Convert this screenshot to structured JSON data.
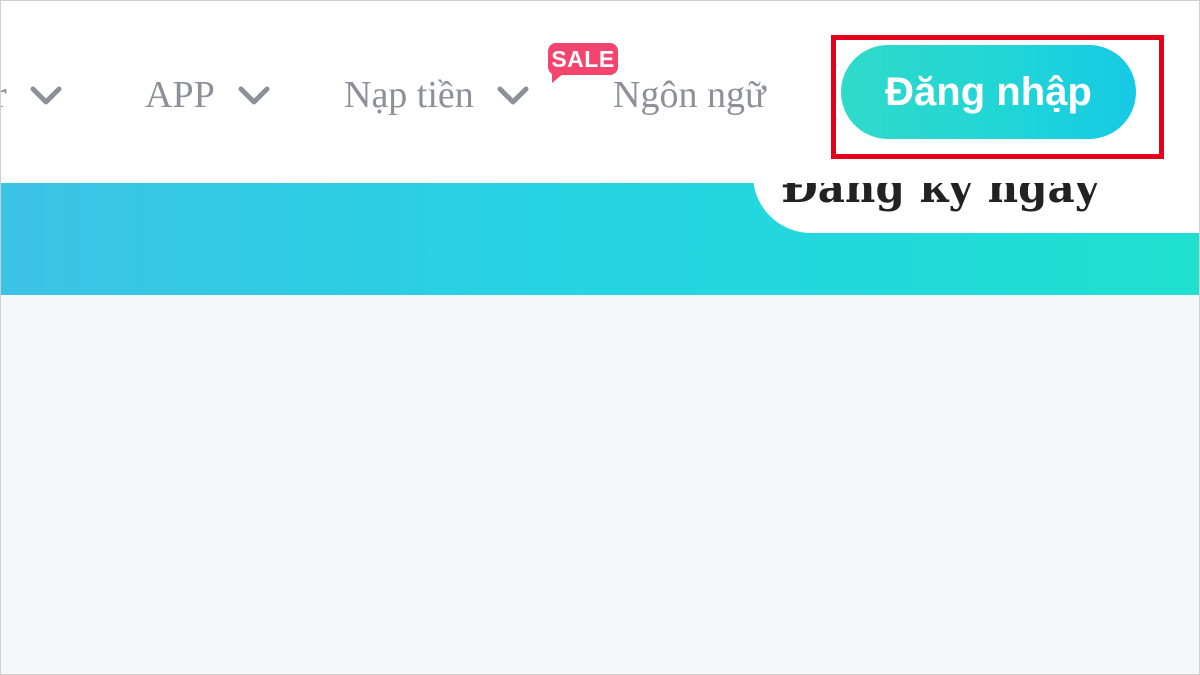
{
  "nav": {
    "partial_item": "or",
    "app": "APP",
    "topup": "Nạp tiền",
    "sale_badge": "SALE",
    "language": "Ngôn ngữ",
    "login_button": "Đăng nhập"
  },
  "banner": {
    "card_text": "Đăng ký ngay"
  },
  "colors": {
    "nav_text": "#8c9099",
    "sale_badge": "#f5456f",
    "login_gradient_start": "#2fdac9",
    "login_gradient_end": "#16c9e6",
    "highlight_border": "#e3001b",
    "banner_gradient_start": "#3cc2e6",
    "banner_gradient_end": "#1fe0cf",
    "content_background": "#f6f7f9"
  }
}
